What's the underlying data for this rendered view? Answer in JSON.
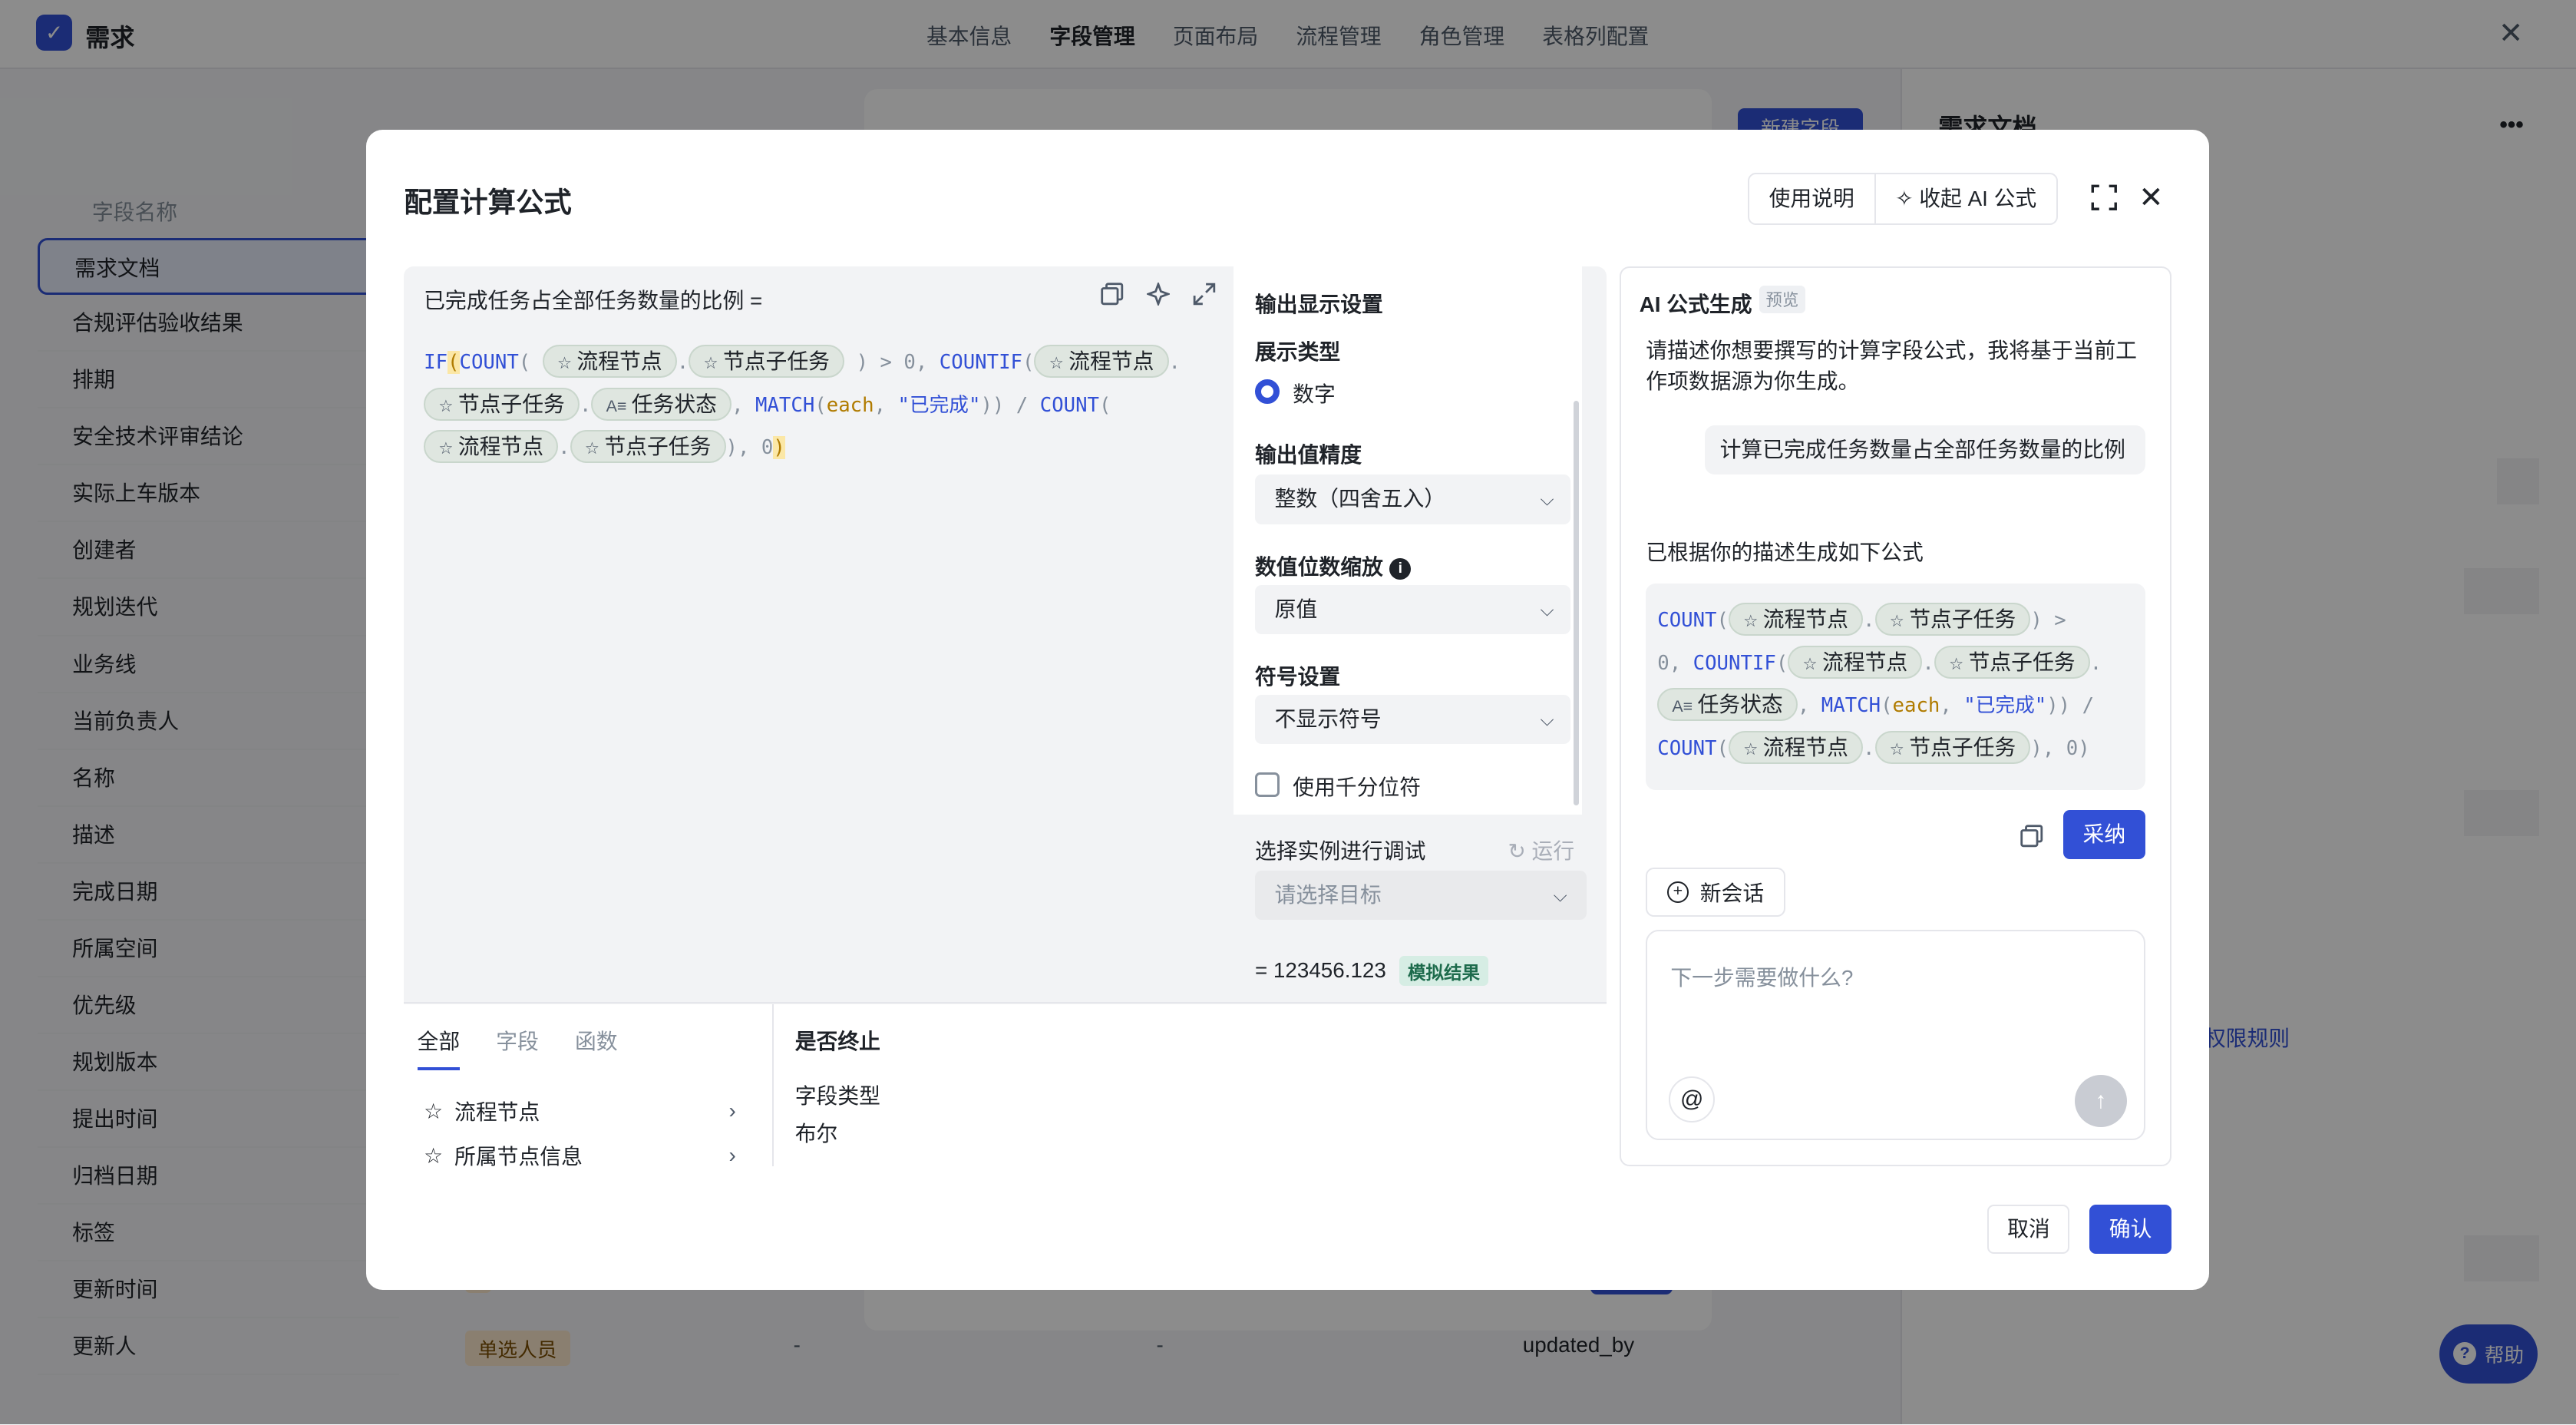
{
  "app": {
    "title": "需求",
    "close": "✕"
  },
  "top_tabs": [
    {
      "label": "基本信息"
    },
    {
      "label": "字段管理"
    },
    {
      "label": "页面布局"
    },
    {
      "label": "流程管理"
    },
    {
      "label": "角色管理"
    },
    {
      "label": "表格列配置"
    }
  ],
  "field_list": {
    "header": "字段名称",
    "items": [
      "需求文档",
      "合规评估验收结果",
      "排期",
      "安全技术评审结论",
      "实际上车版本",
      "创建者",
      "规划迭代",
      "业务线",
      "当前负责人",
      "名称",
      "描述",
      "完成日期",
      "所属空间",
      "优先级",
      "规划版本",
      "提出时间",
      "归档日期",
      "标签",
      "更新时间",
      "更新人"
    ]
  },
  "background_row": {
    "type_tag": "单选人员",
    "col2": "-",
    "col3": "-",
    "key": "updated_by"
  },
  "new_field_button": "新建字段",
  "right_panel": {
    "title": "需求文档",
    "more": "•••",
    "permission_link": "权限规则"
  },
  "help": {
    "label": "帮助",
    "icon": "?"
  },
  "modal": {
    "title": "配置计算公式",
    "usage_label": "使用说明",
    "collapse_ai_label": "收起 AI 公式",
    "formula_name": "已完成任务占全部任务数量的比例 =",
    "formula": {
      "t1": "IF",
      "t2": "(",
      "t3": "COUNT",
      "chip_node": "流程节点",
      "chip_sub": "节点子任务",
      "chip_status": "任务状态",
      "gt0": ") > 0,",
      "countif": "COUNTIF",
      "match": "MATCH",
      "each": "each",
      "done": "\"已完成\"",
      "zero": "0",
      "div": ")) /",
      "count2": "COUNT"
    },
    "bottom": {
      "tabs": [
        "全部",
        "字段",
        "函数"
      ],
      "items": [
        "流程节点",
        "所属节点信息"
      ],
      "detail_title": "是否终止",
      "detail_type_label": "字段类型",
      "detail_type_value": "布尔"
    },
    "settings": {
      "title": "输出显示设置",
      "display_type_label": "展示类型",
      "display_type_value": "数字",
      "precision_label": "输出值精度",
      "precision_value": "整数（四舍五入）",
      "scale_label": "数值位数缩放",
      "scale_value": "原值",
      "symbol_label": "符号设置",
      "symbol_value": "不显示符号",
      "thousands_label": "使用千分位符"
    },
    "debug": {
      "label": "选择实例进行调试",
      "run": "运行",
      "placeholder": "请选择目标",
      "result": "= 123456.123",
      "result_tag": "模拟结果"
    },
    "ai": {
      "title": "AI 公式生成",
      "beta": "预览",
      "desc": "请描述你想要撰写的计算字段公式，我将基于当前工作项数据源为你生成。",
      "user_msg": "计算已完成任务数量占全部任务数量的比例",
      "reply": "已根据你的描述生成如下公式",
      "adopt": "采纳",
      "new_chat": "新会话",
      "placeholder": "下一步需要做什么?",
      "at": "@"
    },
    "cancel": "取消",
    "confirm": "确认"
  },
  "colors": {
    "accent": "#3250d6",
    "chip_bg": "#dfe6e0",
    "overlay": "rgba(0,0,0,0.45)"
  }
}
